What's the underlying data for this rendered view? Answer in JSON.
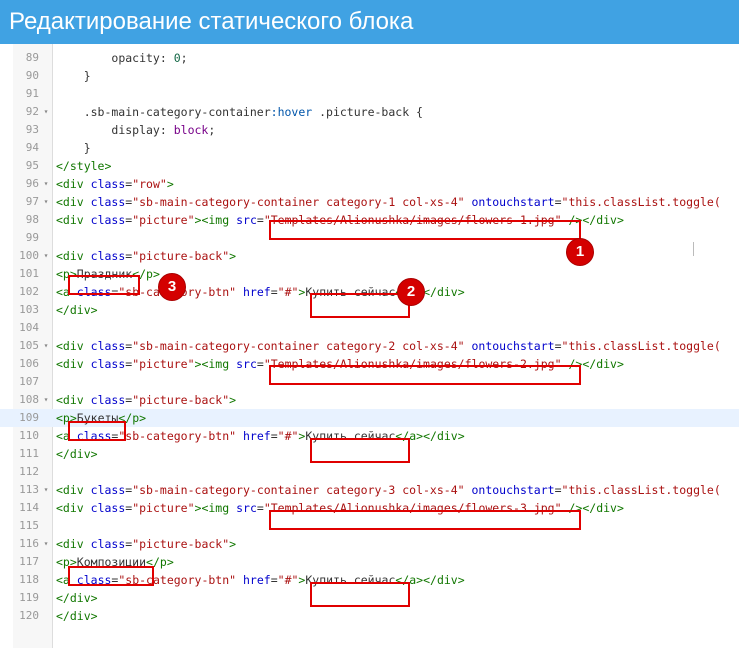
{
  "window": {
    "title": "Редактирование статического блока"
  },
  "editor": {
    "active_line": "109",
    "lines": [
      {
        "n": "89",
        "fold": "",
        "text": "        opacity: 0;"
      },
      {
        "n": "90",
        "fold": "",
        "text": "    }"
      },
      {
        "n": "91",
        "fold": "",
        "text": ""
      },
      {
        "n": "92",
        "fold": "▾",
        "text": "    .sb-main-category-container:hover .picture-back {"
      },
      {
        "n": "93",
        "fold": "",
        "text": "        display: block;"
      },
      {
        "n": "94",
        "fold": "",
        "text": "    }"
      },
      {
        "n": "95",
        "fold": "",
        "text": "</style>"
      },
      {
        "n": "96",
        "fold": "▾",
        "text": "<div class=\"row\">"
      },
      {
        "n": "97",
        "fold": "▾",
        "text": "<div class=\"sb-main-category-container category-1 col-xs-4\" ontouchstart=\"this.classList.toggle("
      },
      {
        "n": "98",
        "fold": "",
        "text": "<div class=\"picture\"><img src=\"Templates/Alionushka/images/flowers-1.jpg\" /></div>"
      },
      {
        "n": "99",
        "fold": "",
        "text": ""
      },
      {
        "n": "100",
        "fold": "▾",
        "text": "<div class=\"picture-back\">"
      },
      {
        "n": "101",
        "fold": "",
        "text": "<p>Праздник</p>"
      },
      {
        "n": "102",
        "fold": "",
        "text": "<a class=\"sb-category-btn\" href=\"#\">Купить сейчас</a></div>"
      },
      {
        "n": "103",
        "fold": "",
        "text": "</div>"
      },
      {
        "n": "104",
        "fold": "",
        "text": ""
      },
      {
        "n": "105",
        "fold": "▾",
        "text": "<div class=\"sb-main-category-container category-2 col-xs-4\" ontouchstart=\"this.classList.toggle("
      },
      {
        "n": "106",
        "fold": "",
        "text": "<div class=\"picture\"><img src=\"Templates/Alionushka/images/flowers-2.jpg\" /></div>"
      },
      {
        "n": "107",
        "fold": "",
        "text": ""
      },
      {
        "n": "108",
        "fold": "▾",
        "text": "<div class=\"picture-back\">"
      },
      {
        "n": "109",
        "fold": "",
        "text": "<p>Букеты</p>"
      },
      {
        "n": "110",
        "fold": "",
        "text": "<a class=\"sb-category-btn\" href=\"#\">Купить сейчас</a></div>"
      },
      {
        "n": "111",
        "fold": "",
        "text": "</div>"
      },
      {
        "n": "112",
        "fold": "",
        "text": ""
      },
      {
        "n": "113",
        "fold": "▾",
        "text": "<div class=\"sb-main-category-container category-3 col-xs-4\" ontouchstart=\"this.classList.toggle("
      },
      {
        "n": "114",
        "fold": "",
        "text": "<div class=\"picture\"><img src=\"Templates/Alionushka/images/flowers-3.jpg\" /></div>"
      },
      {
        "n": "115",
        "fold": "",
        "text": ""
      },
      {
        "n": "116",
        "fold": "▾",
        "text": "<div class=\"picture-back\">"
      },
      {
        "n": "117",
        "fold": "",
        "text": "<p>Композиции</p>"
      },
      {
        "n": "118",
        "fold": "",
        "text": "<a class=\"sb-category-btn\" href=\"#\">Купить сейчас</a></div>"
      },
      {
        "n": "119",
        "fold": "",
        "text": "</div>"
      },
      {
        "n": "120",
        "fold": "",
        "text": "</div>"
      }
    ]
  },
  "annotations": {
    "badges": [
      {
        "label": "1"
      },
      {
        "label": "2"
      },
      {
        "label": "3"
      }
    ]
  },
  "colors": {
    "title_bar": "#40a2e3",
    "highlight_box": "#e00000",
    "badge": "#d40000"
  }
}
